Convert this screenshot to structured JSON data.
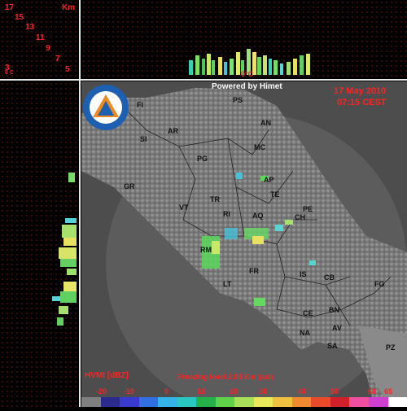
{
  "corner": {
    "title": "17",
    "unit": "Km",
    "ticks": [
      "15",
      "13",
      "11",
      "9",
      "7",
      "5"
    ],
    "bottom_left_labels": [
      "3",
      "0 C"
    ]
  },
  "top_profile": {
    "freezing_marker": "0°C"
  },
  "map": {
    "powered_by": "Powered by Himet",
    "date": "17 May 2010",
    "time": "07:15 CEST",
    "product": "HVMI [dBZ]",
    "freezing_level": "Freezing level  2.05 Km (asl)",
    "logo_lettering": "PROTEZIONE CIVILE REGIONE ABRUZZO",
    "cities": [
      {
        "name": "FI"
      },
      {
        "name": "PS"
      },
      {
        "name": "AR"
      },
      {
        "name": "AN"
      },
      {
        "name": "SI"
      },
      {
        "name": "MC"
      },
      {
        "name": "PG"
      },
      {
        "name": "AP"
      },
      {
        "name": "GR"
      },
      {
        "name": "TE"
      },
      {
        "name": "TR"
      },
      {
        "name": "VT"
      },
      {
        "name": "RI"
      },
      {
        "name": "PE"
      },
      {
        "name": "AQ"
      },
      {
        "name": "CH"
      },
      {
        "name": "RM"
      },
      {
        "name": "FR"
      },
      {
        "name": "IS"
      },
      {
        "name": "CB"
      },
      {
        "name": "FG"
      },
      {
        "name": "LT"
      },
      {
        "name": "CE"
      },
      {
        "name": "BN"
      },
      {
        "name": "NA"
      },
      {
        "name": "AV"
      },
      {
        "name": "SA"
      },
      {
        "name": "PZ"
      }
    ]
  },
  "legend": {
    "labels": [
      "-20",
      "-10",
      "0",
      "10",
      "20",
      "30",
      "40",
      "50",
      "60",
      "65"
    ],
    "colors": [
      "#7f7f7f",
      "#2b2b8f",
      "#3a3acf",
      "#2f6fe0",
      "#35b3e8",
      "#28c8c0",
      "#26b04a",
      "#5fd24a",
      "#a8e05a",
      "#e8e85a",
      "#f0c040",
      "#f08a30",
      "#e84a2a",
      "#d0202a",
      "#f04fa0",
      "#d040d0",
      "#ffffff"
    ]
  }
}
